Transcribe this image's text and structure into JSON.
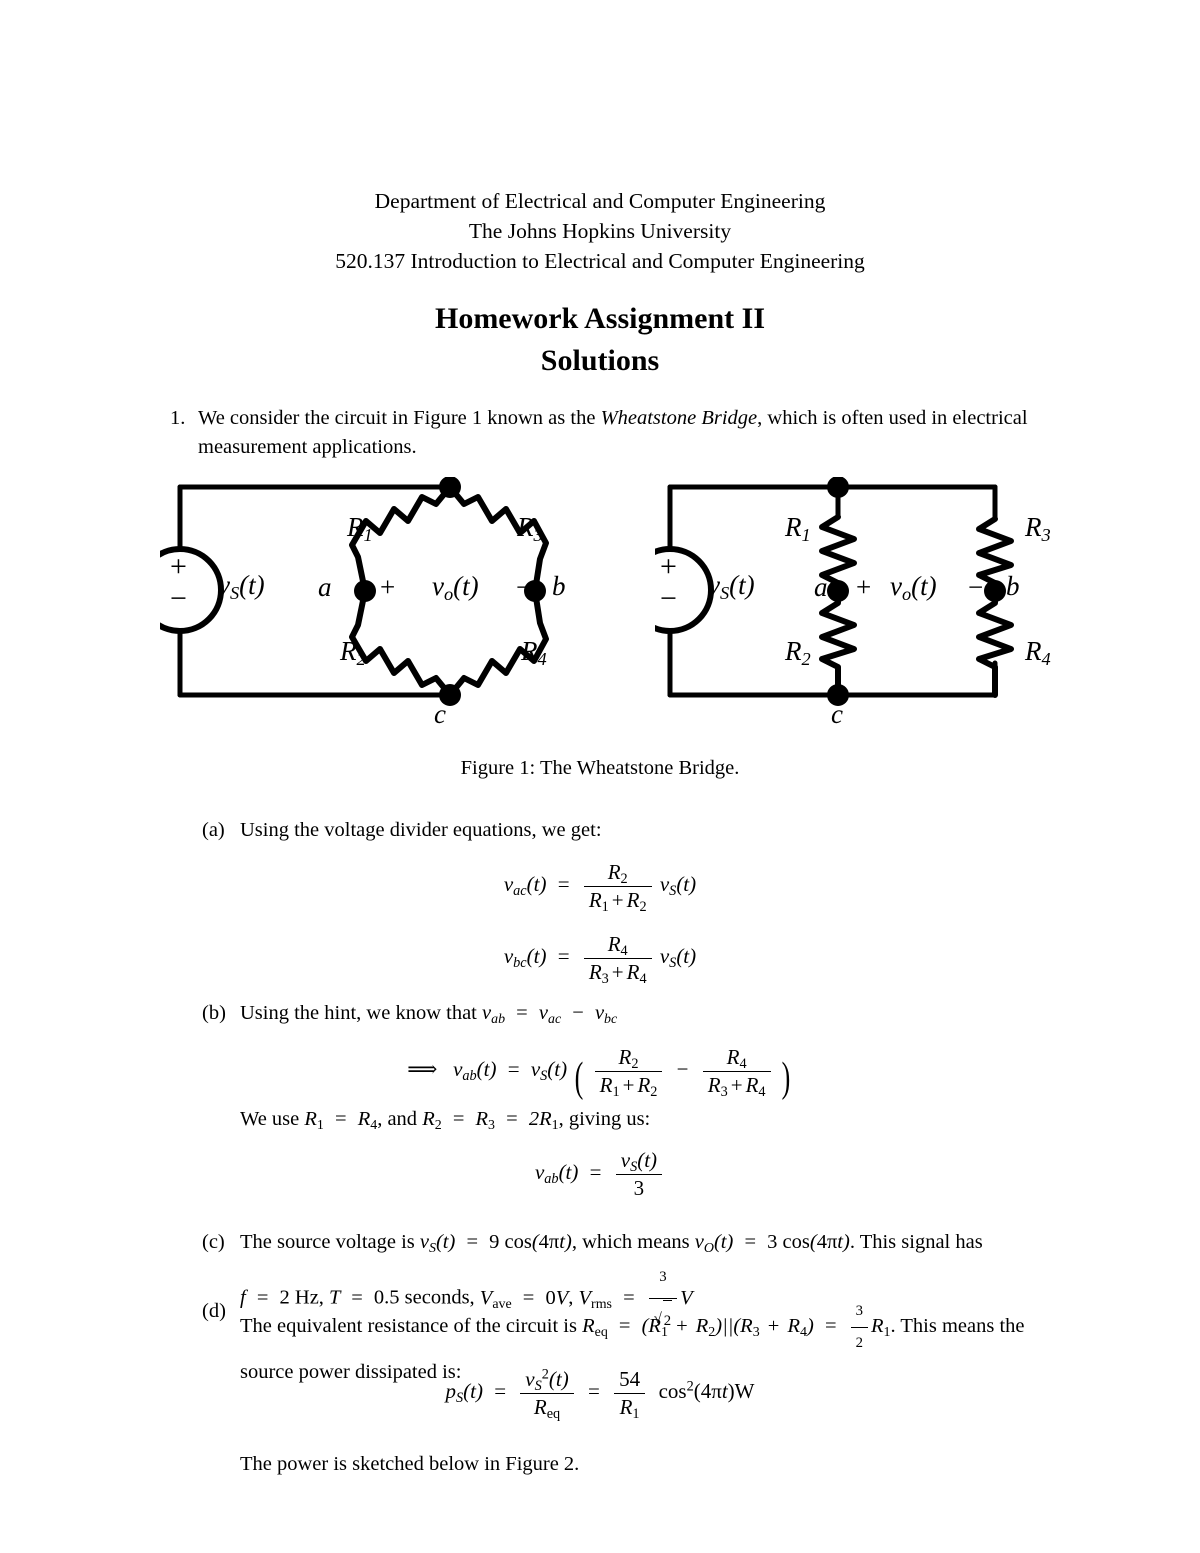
{
  "header": {
    "line1": "Department of Electrical and Computer Engineering",
    "line2": "The Johns Hopkins University",
    "line3": "520.137 Introduction to Electrical and Computer Engineering"
  },
  "title": {
    "line1": "Homework Assignment II",
    "line2": "Solutions"
  },
  "question1": {
    "number": "1.",
    "text_before_italic": "We consider the circuit in Figure 1 known as the ",
    "italic_term": "Wheatstone Bridge",
    "text_after_italic": ", which is often used in electrical measurement applications."
  },
  "figure1": {
    "caption": "Figure 1: The Wheatstone Bridge.",
    "left_circuit": {
      "name": "wheatstone-bridge-diamond",
      "source_label": "v",
      "source_sub": "S",
      "source_arg": "(t)",
      "source_plus": "+",
      "source_minus": "−",
      "resistors": [
        "R1",
        "R3",
        "R2",
        "R4"
      ],
      "resistor_labels": [
        {
          "base": "R",
          "sub": "1"
        },
        {
          "base": "R",
          "sub": "3"
        },
        {
          "base": "R",
          "sub": "2"
        },
        {
          "base": "R",
          "sub": "4"
        }
      ],
      "node_a": "a",
      "node_b": "b",
      "node_c": "c",
      "vo_label": "v",
      "vo_sub": "o",
      "vo_arg": "(t)",
      "vo_plus": "+",
      "vo_minus": "−"
    },
    "right_circuit": {
      "name": "wheatstone-bridge-ladder",
      "source_label": "v",
      "source_sub": "S",
      "source_arg": "(t)",
      "source_plus": "+",
      "source_minus": "−",
      "resistor_labels": [
        {
          "base": "R",
          "sub": "1"
        },
        {
          "base": "R",
          "sub": "3"
        },
        {
          "base": "R",
          "sub": "2"
        },
        {
          "base": "R",
          "sub": "4"
        }
      ],
      "node_a": "a",
      "node_b": "b",
      "node_c": "c",
      "vo_label": "v",
      "vo_sub": "o",
      "vo_arg": "(t)",
      "vo_plus": "+",
      "vo_minus": "−"
    }
  },
  "parts": {
    "a": {
      "label": "(a)",
      "text": "Using the voltage divider equations, we get:"
    },
    "b": {
      "label": "(b)",
      "text_prefix": "Using the hint, we know that ",
      "hint_eq": "v_ab = v_ac − v_bc",
      "we_use_text": "We use R1 = R4, and R2 = R3 = 2R1, giving us:"
    },
    "c": {
      "label": "(c)",
      "line1": "The source voltage is vS(t) = 9 cos(4πt), which means vO(t) = 3 cos(4πt). This signal has",
      "line2": "f = 2 Hz, T = 0.5 seconds, Vave = 0V, Vrms = 3/√2 V",
      "frequency": "2",
      "frequency_unit": "Hz",
      "period": "0.5",
      "period_unit": "seconds",
      "v_ave": "0",
      "v_ave_unit": "V",
      "v_rms_num": "3",
      "v_rms_den": "2",
      "v_rms_unit": "V",
      "source_amplitude": "9",
      "output_amplitude": "3",
      "omega": "4π"
    },
    "d": {
      "label": "(d)",
      "line1": "The equivalent resistance of the circuit is Req = (R1 + R2)||(R3 + R4) = 3/2 R1. This means the",
      "line2": "source power dissipated is:",
      "closing": "The power is sketched below in Figure 2.",
      "power_numerator": "54"
    }
  },
  "equations": {
    "vac": "v_ac(t) = R2/(R1 + R2) vS(t)",
    "vbc": "v_bc(t) = R4/(R3 + R4) vS(t)",
    "vab_expanded": "⟹ v_ab(t) = vS(t) ( R2/(R1 + R2) − R4/(R3 + R4) )",
    "vab_simple": "v_ab(t) = vS(t)/3",
    "power": "pS(t) = vS²(t)/Req = 54/R1 cos²(4πt) W"
  },
  "colors": {
    "ink": "#000000",
    "paper": "#ffffff"
  }
}
